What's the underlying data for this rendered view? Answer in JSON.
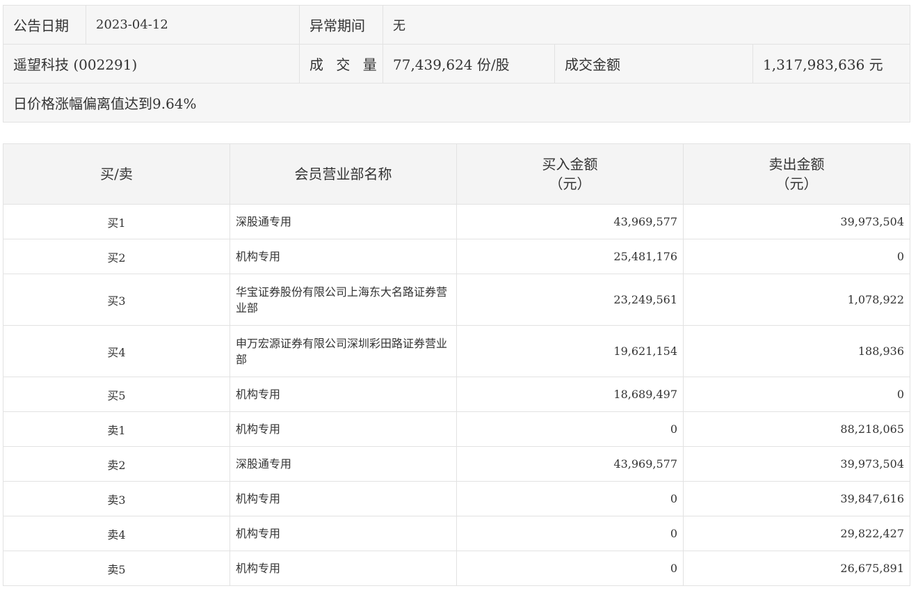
{
  "info": {
    "date_label": "公告日期",
    "date_value": "2023-04-12",
    "period_label": "异常期间",
    "period_value": "无",
    "stock": "遥望科技 (002291)",
    "volume_label": "成 交 量",
    "volume_value": "77,439,624 份/股",
    "amount_label": "成交金额",
    "amount_value": "1,317,983,636 元",
    "reason": "日价格涨幅偏离值达到9.64%"
  },
  "headers": {
    "side": "买/卖",
    "dept": "会员营业部名称",
    "buy": "买入金额",
    "buy_unit": "（元）",
    "sell": "卖出金额",
    "sell_unit": "（元）"
  },
  "rows": [
    {
      "side": "买1",
      "dept": "深股通专用",
      "buy": "43,969,577",
      "sell": "39,973,504"
    },
    {
      "side": "买2",
      "dept": "机构专用",
      "buy": "25,481,176",
      "sell": "0"
    },
    {
      "side": "买3",
      "dept": "华宝证券股份有限公司上海东大名路证券营业部",
      "buy": "23,249,561",
      "sell": "1,078,922"
    },
    {
      "side": "买4",
      "dept": "申万宏源证券有限公司深圳彩田路证券营业部",
      "buy": "19,621,154",
      "sell": "188,936"
    },
    {
      "side": "买5",
      "dept": "机构专用",
      "buy": "18,689,497",
      "sell": "0"
    },
    {
      "side": "卖1",
      "dept": "机构专用",
      "buy": "0",
      "sell": "88,218,065"
    },
    {
      "side": "卖2",
      "dept": "深股通专用",
      "buy": "43,969,577",
      "sell": "39,973,504"
    },
    {
      "side": "卖3",
      "dept": "机构专用",
      "buy": "0",
      "sell": "39,847,616"
    },
    {
      "side": "卖4",
      "dept": "机构专用",
      "buy": "0",
      "sell": "29,822,427"
    },
    {
      "side": "卖5",
      "dept": "机构专用",
      "buy": "0",
      "sell": "26,675,891"
    }
  ]
}
